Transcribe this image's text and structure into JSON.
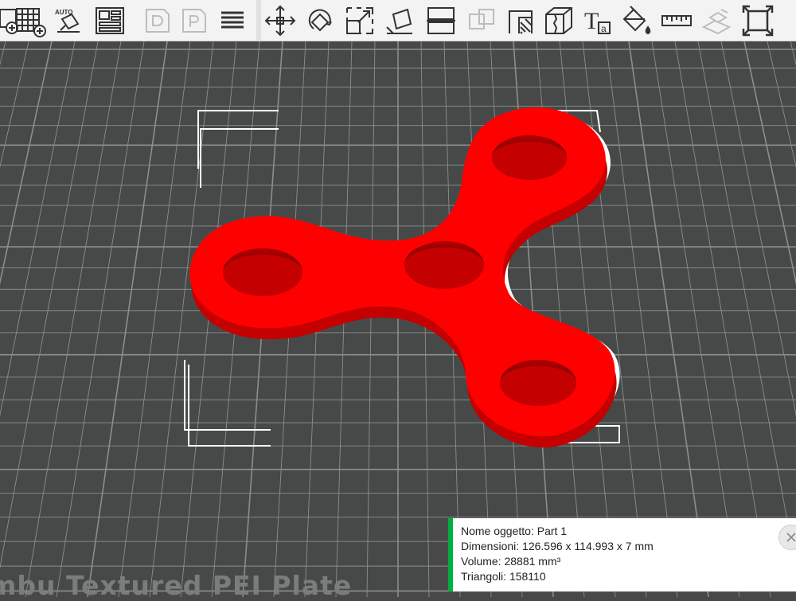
{
  "toolbar": {
    "buttons": [
      {
        "name": "add-part-icon",
        "enabled": true
      },
      {
        "name": "add-plate-icon",
        "enabled": true
      },
      {
        "name": "auto-orient-icon",
        "enabled": true,
        "label": "AUTO"
      },
      {
        "name": "arrange-icon",
        "enabled": true
      },
      {
        "name": "split-objects-icon",
        "enabled": false
      },
      {
        "name": "split-parts-icon",
        "enabled": false
      },
      {
        "name": "layers-icon",
        "enabled": true
      },
      {
        "name": "move-icon",
        "enabled": true
      },
      {
        "name": "rotate-icon",
        "enabled": true
      },
      {
        "name": "scale-icon",
        "enabled": true
      },
      {
        "name": "lay-on-face-icon",
        "enabled": true
      },
      {
        "name": "cut-icon",
        "enabled": true
      },
      {
        "name": "mesh-boolean-icon",
        "enabled": false
      },
      {
        "name": "support-paint-icon",
        "enabled": true
      },
      {
        "name": "seam-paint-icon",
        "enabled": true
      },
      {
        "name": "text-emboss-icon",
        "enabled": true,
        "label": "T",
        "sub_label": "a"
      },
      {
        "name": "color-paint-icon",
        "enabled": true
      },
      {
        "name": "measure-icon",
        "enabled": true
      },
      {
        "name": "assembly-icon",
        "enabled": false
      },
      {
        "name": "fit-view-icon",
        "enabled": true
      }
    ]
  },
  "scene": {
    "plate_label": "mbu Textured PEI Plate",
    "object_color": "#ff0000",
    "grid_background": "#474949",
    "grid_line_color": "#8c8e8e"
  },
  "info_panel": {
    "name_label": "Nome oggetto:",
    "name_value": "Part 1",
    "size_label": "Dimensioni:",
    "size_value": "126.596 x 114.993 x 7 mm",
    "volume_label": "Volume:",
    "volume_value": "28881 mm³",
    "triangles_label": "Triangoli:",
    "triangles_value": "158110",
    "accent_color": "#00ae42"
  }
}
